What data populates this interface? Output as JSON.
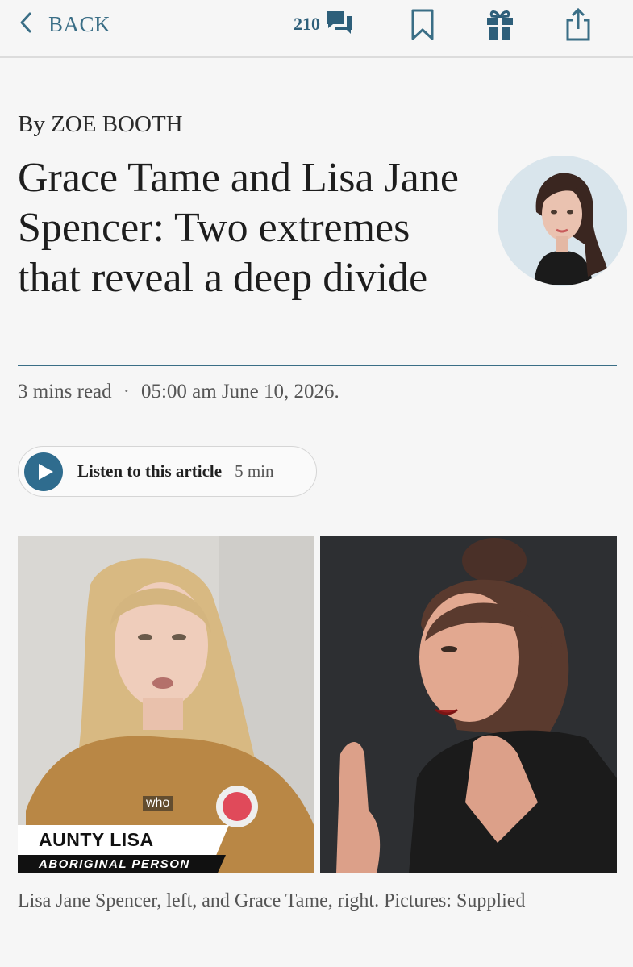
{
  "toolbar": {
    "back_label": "BACK",
    "comment_count": "210",
    "icons": [
      "chevron-left-icon",
      "comment-icon",
      "bookmark-icon",
      "gift-icon",
      "share-icon"
    ],
    "accent_color": "#3a6e86"
  },
  "article": {
    "byline": "By ZOE BOOTH",
    "headline": "Grace Tame and Lisa Jane Spencer: Two extremes that reveal a deep divide",
    "read_time": "3 mins read",
    "separator": "·",
    "published": "05:00 am June 10, 2026.",
    "rule_color": "#3a6e86"
  },
  "listen": {
    "label": "Listen to this article",
    "duration": "5 min",
    "button_color": "#2f6c8e"
  },
  "image": {
    "left_lower_third_name": "AUNTY LISA",
    "left_lower_third_role": "ABORIGINAL PERSON",
    "left_subtitle": "who",
    "caption": "Lisa Jane Spencer, left, and Grace Tame, right. Pictures: Supplied"
  }
}
